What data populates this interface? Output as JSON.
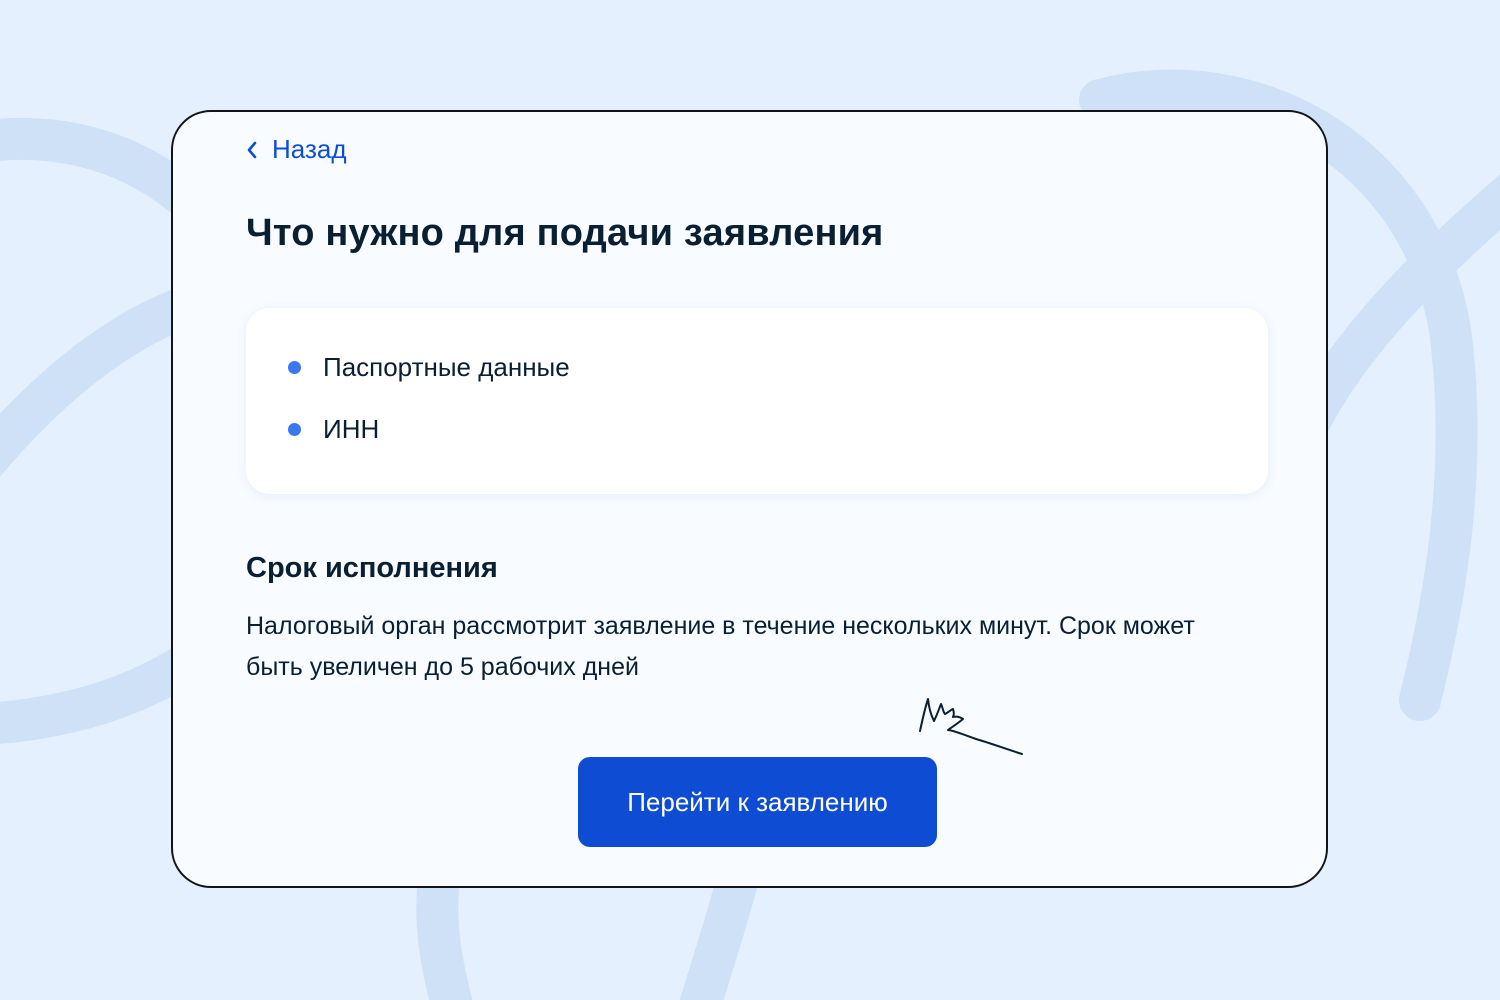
{
  "back_link": {
    "label": "Назад"
  },
  "page_title": "Что нужно для подачи заявления",
  "requirements": [
    {
      "label": "Паспортные данные"
    },
    {
      "label": "ИНН"
    }
  ],
  "execution_term": {
    "title": "Срок исполнения",
    "text": "Налоговый орган рассмотрит заявление в течение нескольких минут. Срок может быть увеличен до 5 рабочих дней"
  },
  "cta_button": {
    "label": "Перейти к заявлению"
  },
  "icons": {
    "back": "chevron-left-icon",
    "signature": "handwritten-signature"
  },
  "colors": {
    "background": "#e4f0fd",
    "card": "#f8fbff",
    "accent": "#0d4cd3",
    "bullet": "#3a78f2",
    "text": "#0b1f33",
    "decor": "#cfe1f7"
  }
}
